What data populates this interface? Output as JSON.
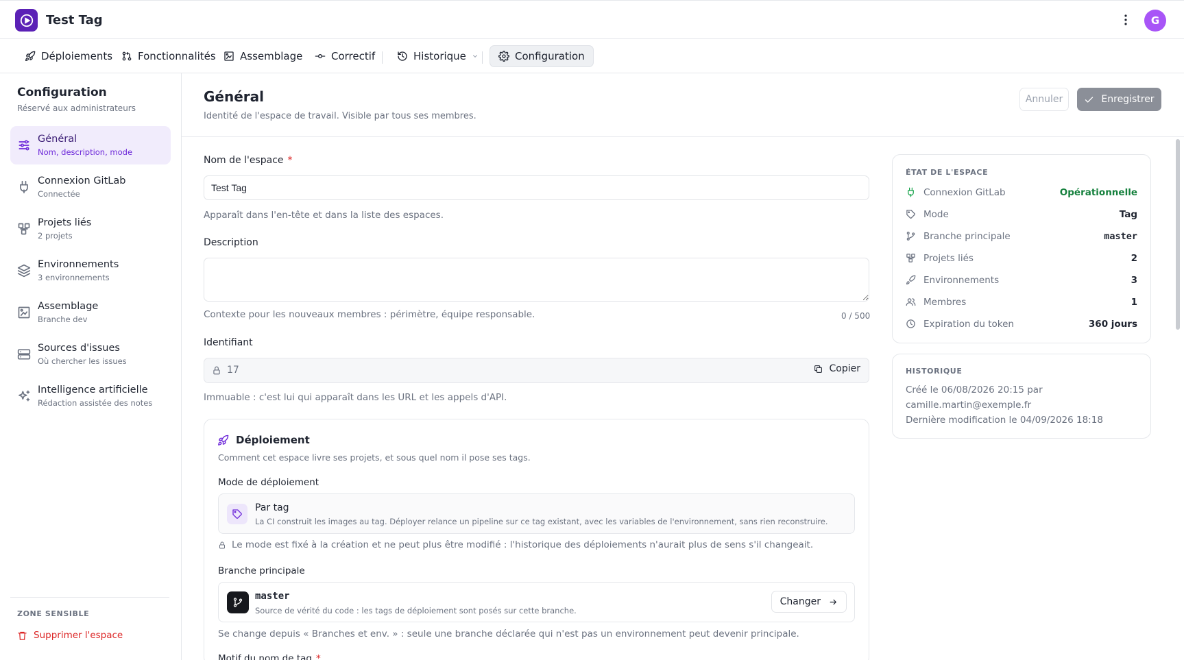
{
  "app": {
    "title": "Test Tag",
    "avatar_initial": "G",
    "brand_color": "#5b21b6"
  },
  "nav": {
    "tabs": [
      {
        "label": "Déploiements",
        "icon": "rocket-icon"
      },
      {
        "label": "Fonctionnalités",
        "icon": "git-pull-request-icon"
      },
      {
        "label": "Assemblage",
        "icon": "frame-icon"
      },
      {
        "label": "Correctif",
        "icon": "git-commit-icon"
      },
      {
        "label": "Historique",
        "icon": "history-icon"
      },
      {
        "label": "Configuration",
        "icon": "gear-icon",
        "active": true
      }
    ]
  },
  "sidebar": {
    "title": "Configuration",
    "subtitle": "Réservé aux administrateurs",
    "items": [
      {
        "label": "Général",
        "sub": "Nom, description, mode",
        "icon": "sliders-icon",
        "active": true
      },
      {
        "label": "Connexion GitLab",
        "sub": "Connectée",
        "icon": "plug-icon"
      },
      {
        "label": "Projets liés",
        "sub": "2 projets",
        "icon": "workflow-icon"
      },
      {
        "label": "Environnements",
        "sub": "3 environnements",
        "icon": "layers-icon"
      },
      {
        "label": "Assemblage",
        "sub": "Branche dev",
        "icon": "frame-icon"
      },
      {
        "label": "Sources d'issues",
        "sub": "Où chercher les issues",
        "icon": "server-icon"
      },
      {
        "label": "Intelligence artificielle",
        "sub": "Rédaction assistée des notes",
        "icon": "sparkles-icon"
      }
    ],
    "danger_zone": {
      "title": "ZONE SENSIBLE",
      "delete_label": "Supprimer l'espace"
    }
  },
  "header": {
    "title": "Général",
    "description": "Identité de l'espace de travail. Visible par tous ses membres.",
    "cancel_label": "Annuler",
    "save_label": "Enregistrer"
  },
  "form": {
    "name": {
      "label": "Nom de l'espace",
      "required_mark": "*",
      "value": "Test Tag",
      "help": "Apparaît dans l'en-tête et dans la liste des espaces."
    },
    "description": {
      "label": "Description",
      "value": "",
      "help": "Contexte pour les nouveaux membres : périmètre, équipe responsable.",
      "counter": "0 / 500"
    },
    "identifier": {
      "label": "Identifiant",
      "value": "17",
      "copy_label": "Copier",
      "help": "Immuable : c'est lui qui apparaît dans les URL et les appels d'API."
    }
  },
  "deploy": {
    "title": "Déploiement",
    "description": "Comment cet espace livre ses projets, et sous quel nom il pose ses tags.",
    "mode_label": "Mode de déploiement",
    "mode_name": "Par tag",
    "mode_desc": "La CI construit les images au tag. Déployer relance un pipeline sur ce tag existant, avec les variables de l'environnement, sans rien reconstruire.",
    "mode_note": "Le mode est fixé à la création et ne peut plus être modifié : l'historique des déploiements n'aurait plus de sens s'il changeait.",
    "branch_label": "Branche principale",
    "branch_name": "master",
    "branch_desc": "Source de vérité du code : les tags de déploiement sont posés sur cette branche.",
    "change_label": "Changer",
    "branch_note": "Se change depuis « Branches et env. » : seule une branche déclarée qui n'est pas un environnement peut devenir principale.",
    "next_label": "Motif du nom de tag",
    "next_required": "*"
  },
  "status_panel": {
    "title": "ÉTAT DE L'ESPACE",
    "rows": [
      {
        "key": "Connexion GitLab",
        "value": "Opérationnelle",
        "icon": "plug-icon",
        "ok": true
      },
      {
        "key": "Mode",
        "value": "Tag",
        "icon": "tag-icon"
      },
      {
        "key": "Branche principale",
        "value": "master",
        "icon": "git-branch-icon",
        "mono": true
      },
      {
        "key": "Projets liés",
        "value": "2",
        "icon": "workflow-icon"
      },
      {
        "key": "Environnements",
        "value": "3",
        "icon": "rocket-icon"
      },
      {
        "key": "Membres",
        "value": "1",
        "icon": "users-icon"
      },
      {
        "key": "Expiration du token",
        "value": "360 jours",
        "icon": "clock-icon"
      }
    ],
    "ok_color": "#15803d"
  },
  "history_panel": {
    "title": "HISTORIQUE",
    "lines": [
      "Créé le 06/08/2026 20:15 par",
      "camille.martin@exemple.fr",
      "Dernière modification le 04/09/2026 18:18"
    ]
  }
}
